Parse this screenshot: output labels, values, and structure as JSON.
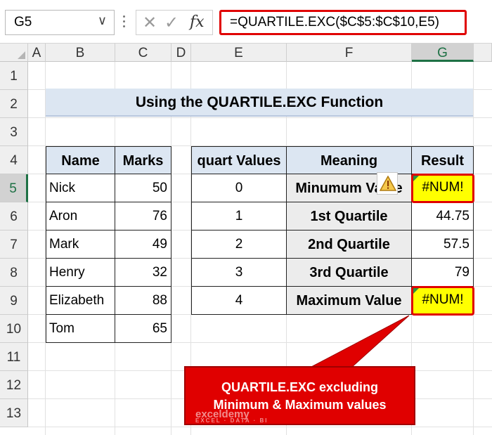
{
  "formula_bar": {
    "name_box": "G5",
    "dropdown_glyph": "∨",
    "cancel_glyph": "✕",
    "enter_glyph": "✓",
    "fx_glyph": "fx",
    "formula": "=QUARTILE.EXC($C$5:$C$10,E5)"
  },
  "columns": [
    "A",
    "B",
    "C",
    "D",
    "E",
    "F",
    "G"
  ],
  "selected_column": "G",
  "rows": [
    "1",
    "2",
    "3",
    "4",
    "5",
    "6",
    "7",
    "8",
    "9",
    "10",
    "11",
    "12",
    "13"
  ],
  "selected_row": "5",
  "title": "Using the QUARTILE.EXC Function",
  "marks_table": {
    "headers": [
      "Name",
      "Marks"
    ],
    "rows": [
      {
        "name": "Nick",
        "marks": "50"
      },
      {
        "name": "Aron",
        "marks": "76"
      },
      {
        "name": "Mark",
        "marks": "49"
      },
      {
        "name": "Henry",
        "marks": "32"
      },
      {
        "name": "Elizabeth",
        "marks": "88"
      },
      {
        "name": "Tom",
        "marks": "65"
      }
    ]
  },
  "quartile_table": {
    "headers": [
      "quart Values",
      "Meaning",
      "Result"
    ],
    "rows": [
      {
        "quart": "0",
        "meaning": "Minumum Value",
        "result": "#NUM!"
      },
      {
        "quart": "1",
        "meaning": "1st Quartile",
        "result": "44.75"
      },
      {
        "quart": "2",
        "meaning": "2nd Quartile",
        "result": "57.5"
      },
      {
        "quart": "3",
        "meaning": "3rd Quartile",
        "result": "79"
      },
      {
        "quart": "4",
        "meaning": "Maximum Value",
        "result": "#NUM!"
      }
    ]
  },
  "callout": {
    "line1": "QUARTILE.EXC excluding",
    "line2": "Minimum & Maximum values"
  },
  "watermark": {
    "brand": "exceldemy",
    "tagline": "EXCEL · DATA · BI"
  },
  "colors": {
    "accent_red": "#e00000",
    "error_fill": "#ffff00",
    "header_blue": "#dce6f2",
    "excel_green": "#1e7145"
  },
  "icons": [
    "dropdown-icon",
    "cancel-icon",
    "enter-icon",
    "fx-icon",
    "warning-icon"
  ]
}
